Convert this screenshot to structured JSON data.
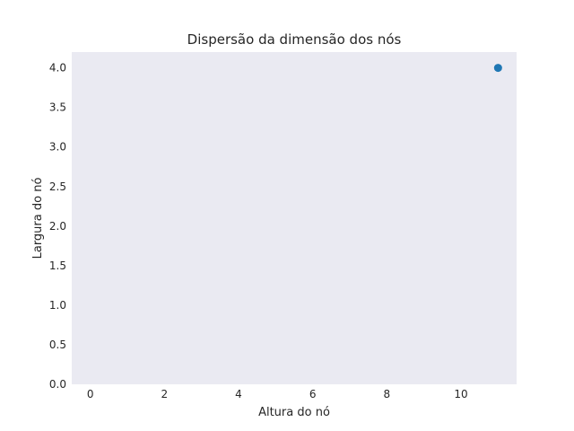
{
  "chart_data": {
    "type": "scatter",
    "title": "Dispersão da dimensão dos nós",
    "xlabel": "Altura do nó",
    "ylabel": "Largura do nó",
    "xlim": [
      -0.5,
      11.5
    ],
    "ylim": [
      0.0,
      4.2
    ],
    "xticks": [
      0,
      2,
      4,
      6,
      8,
      10
    ],
    "xtick_labels": [
      "0",
      "2",
      "4",
      "6",
      "8",
      "10"
    ],
    "yticks": [
      0.0,
      0.5,
      1.0,
      1.5,
      2.0,
      2.5,
      3.0,
      3.5,
      4.0
    ],
    "ytick_labels": [
      "0.0",
      "0.5",
      "1.0",
      "1.5",
      "2.0",
      "2.5",
      "3.0",
      "3.5",
      "4.0"
    ],
    "grid": false,
    "points": [
      {
        "x": 11,
        "y": 4.0
      }
    ],
    "colors": {
      "plot_background": "#eaeaf2",
      "marker": "#1f77b4",
      "text": "#262626"
    }
  }
}
